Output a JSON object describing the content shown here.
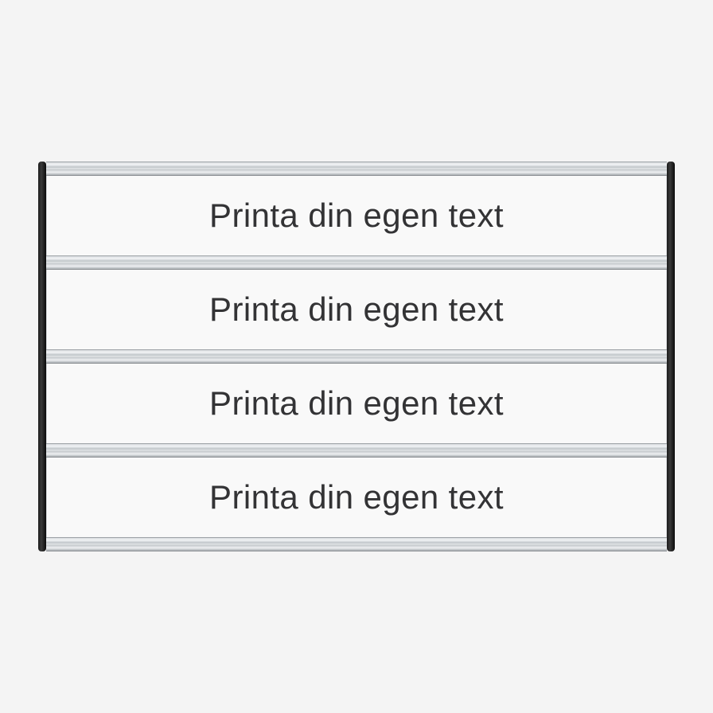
{
  "sign": {
    "slats": [
      {
        "text": "Printa din egen text"
      },
      {
        "text": "Printa din egen text"
      },
      {
        "text": "Printa din egen text"
      },
      {
        "text": "Printa din egen text"
      }
    ]
  }
}
